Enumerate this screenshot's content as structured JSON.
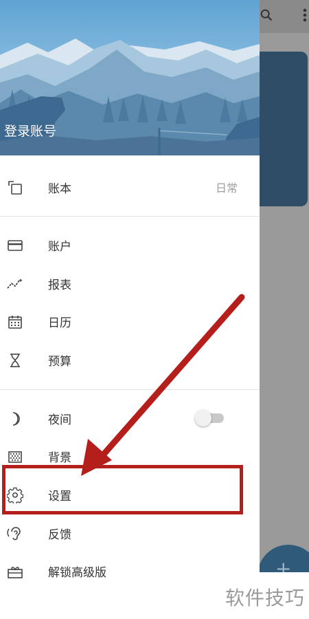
{
  "header": {
    "login_label": "登录账号"
  },
  "menu": {
    "ledger": {
      "label": "账本",
      "value": "日常",
      "icon": "copy-icon"
    },
    "accounts": {
      "label": "账户",
      "icon": "credit-card-icon"
    },
    "reports": {
      "label": "报表",
      "icon": "trending-icon"
    },
    "calendar": {
      "label": "日历",
      "icon": "calendar-icon"
    },
    "budget": {
      "label": "预算",
      "icon": "hourglass-icon"
    },
    "night_mode": {
      "label": "夜间",
      "icon": "moon-icon",
      "enabled": false
    },
    "background": {
      "label": "背景",
      "icon": "texture-icon"
    },
    "settings": {
      "label": "设置",
      "icon": "gear-icon"
    },
    "feedback": {
      "label": "反馈",
      "icon": "ear-icon"
    },
    "unlock_premium": {
      "label": "解锁高级版",
      "icon": "gift-icon"
    }
  },
  "watermark": "软件技巧",
  "fab": {
    "symbol": "+"
  },
  "colors": {
    "annotation_red": "#b51f1b",
    "drawer_bg": "#ffffff",
    "scrim": "#9a9a9a"
  }
}
